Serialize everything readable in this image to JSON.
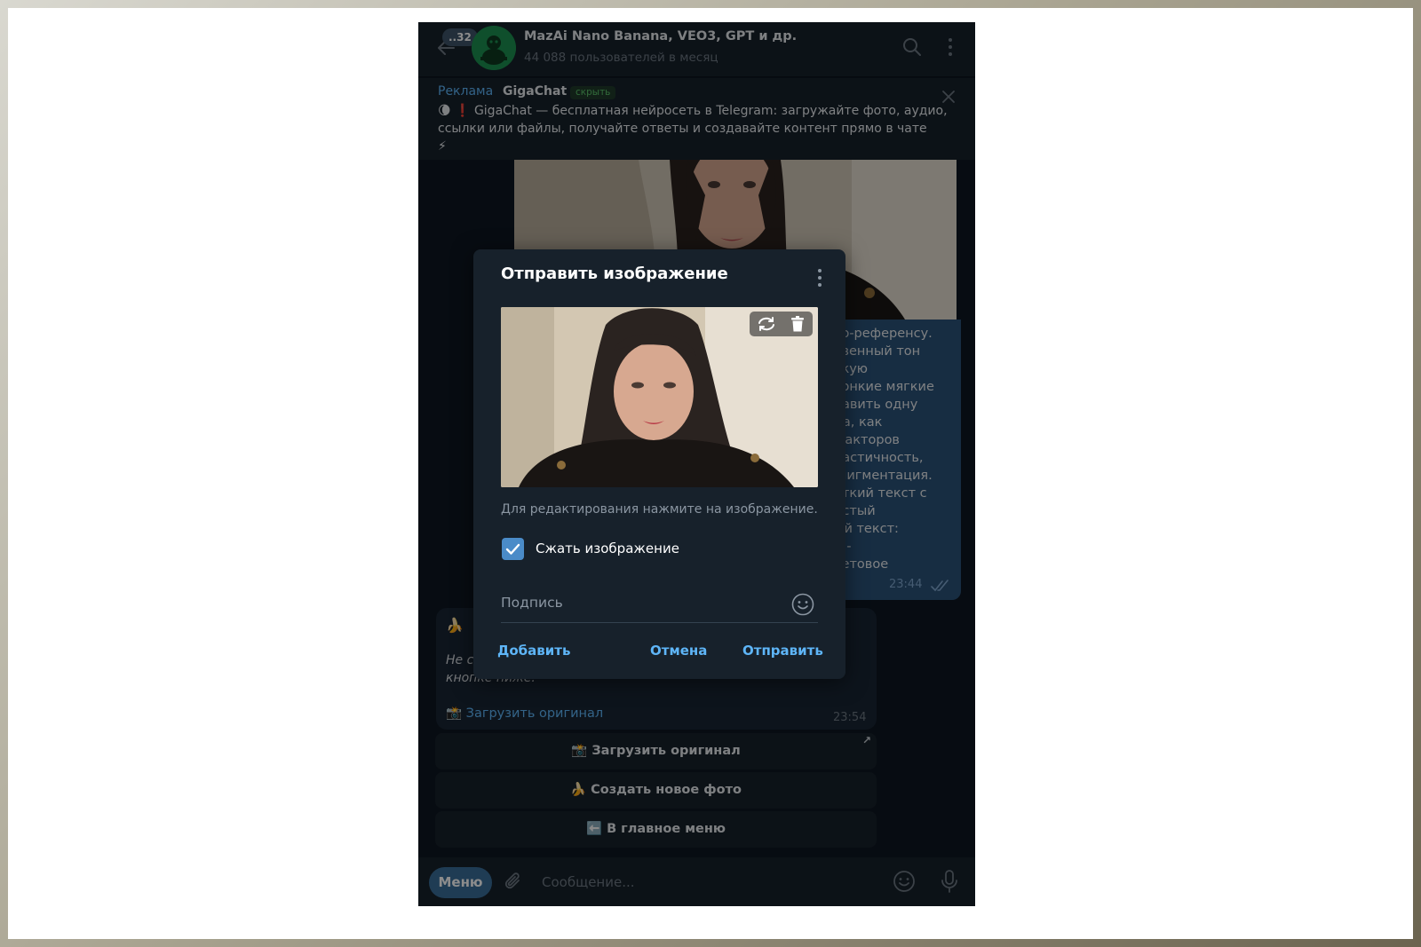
{
  "header": {
    "back_badge": "..32",
    "title": "MazAi Nano Banana, VEO3, GPT и др.",
    "subtitle": "44 088 пользователей в месяц"
  },
  "ad": {
    "label": "Реклама",
    "name": "GigaChat",
    "hide_label": "скрыть",
    "text": "GigaChat — бесплатная нейросеть в Telegram: загружайте фото, аудио, ссылки или файлы, получайте ответы и создавайте контент прямо в чате",
    "lead_emoji": "🌘 ❗",
    "trail_emoji": "⚡"
  },
  "chat": {
    "bubble_lines": [
      "то-референсу.",
      "твенный тон",
      "ткую",
      "тонкие мягкие",
      "бавить одну",
      "ца, как",
      "факторов",
      "ластичность,",
      "/пигментация.",
      "откий текст с",
      "истый",
      "ый текст:",
      "AI-",
      "ветовое"
    ],
    "bubble_time": "23:44",
    "bot_emoji": "🍌",
    "bot_italic_1": "Не с",
    "bot_italic_2": "кнопке ниже.",
    "bot_link": "📸 Загрузить оригинал",
    "bot_time": "23:54",
    "keyboard": [
      "📸 Загрузить оригинал",
      "🍌 Создать новое фото",
      "⬅️ В главное меню"
    ]
  },
  "composer": {
    "menu_label": "Меню",
    "placeholder": "Сообщение..."
  },
  "dialog": {
    "title": "Отправить изображение",
    "edit_hint": "Для редактирования нажмите на изображение.",
    "compress_label": "Сжать изображение",
    "compress_checked": true,
    "caption_placeholder": "Подпись",
    "add_label": "Добавить",
    "cancel_label": "Отмена",
    "send_label": "Отправить"
  },
  "colors": {
    "background": "#0e1621",
    "panel": "#17212b",
    "accent": "#5eb5f7",
    "outgoing_bubble": "#2b5278"
  },
  "icons": [
    "back-icon",
    "search-icon",
    "more-icon",
    "close-icon",
    "rotate-icon",
    "delete-icon",
    "checkmark-icon",
    "emoji-icon",
    "attach-icon",
    "mic-icon"
  ]
}
